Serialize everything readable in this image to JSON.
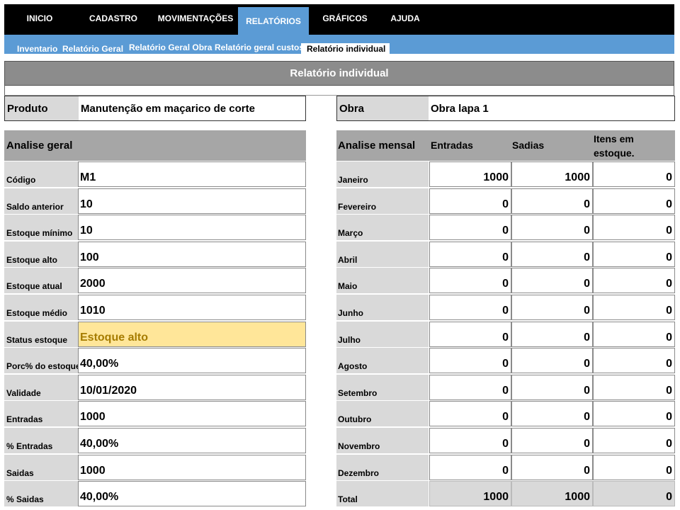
{
  "nav": {
    "items": [
      "INICIO",
      "CADASTRO",
      "MOVIMENTAÇÕES",
      "RELATÓRIOS",
      "GRÁFICOS",
      "AJUDA"
    ],
    "active": "RELATÓRIOS"
  },
  "subnav": {
    "tabs": [
      "Inventario",
      "Relatório  Geral",
      "Relatório  Geral Obra",
      "Relatório  geral custos",
      "Relatório  individual"
    ],
    "active": "Relatório  individual"
  },
  "title": "Relatório individual",
  "produto": {
    "label": "Produto",
    "value": "Manutenção em maçarico de corte"
  },
  "obra": {
    "label": "Obra",
    "value": "Obra lapa 1"
  },
  "analise_geral": {
    "header": "Analise geral",
    "rows": [
      {
        "label": "Código",
        "value": "M1"
      },
      {
        "label": "Saldo anterior",
        "value": "10"
      },
      {
        "label": "Estoque mínimo",
        "value": "10"
      },
      {
        "label": "Estoque alto",
        "value": "100"
      },
      {
        "label": "Estoque atual",
        "value": "2000"
      },
      {
        "label": "Estoque médio",
        "value": "1010"
      },
      {
        "label": "Status estoque",
        "value": "Estoque alto"
      },
      {
        "label": "Porc% do estoque",
        "value": "40,00%"
      },
      {
        "label": "Validade",
        "value": "10/01/2020"
      },
      {
        "label": "Entradas",
        "value": "1000"
      },
      {
        "label": "% Entradas",
        "value": "40,00%"
      },
      {
        "label": "Saidas",
        "value": "1000"
      },
      {
        "label": "% Saidas",
        "value": "40,00%"
      }
    ],
    "status_color": "#ffe699",
    "status_text_color": "#a67c00"
  },
  "analise_mensal": {
    "header": "Analise mensal",
    "col_entradas": "Entradas",
    "col_saidas": "Sadias",
    "col_itens": "Itens em estoque.",
    "rows": [
      {
        "month": "Janeiro",
        "entradas": "1000",
        "saidas": "1000",
        "itens": "0"
      },
      {
        "month": "Fevereiro",
        "entradas": "0",
        "saidas": "0",
        "itens": "0"
      },
      {
        "month": "Março",
        "entradas": "0",
        "saidas": "0",
        "itens": "0"
      },
      {
        "month": "Abril",
        "entradas": "0",
        "saidas": "0",
        "itens": "0"
      },
      {
        "month": "Maio",
        "entradas": "0",
        "saidas": "0",
        "itens": "0"
      },
      {
        "month": "Junho",
        "entradas": "0",
        "saidas": "0",
        "itens": "0"
      },
      {
        "month": "Julho",
        "entradas": "0",
        "saidas": "0",
        "itens": "0"
      },
      {
        "month": "Agosto",
        "entradas": "0",
        "saidas": "0",
        "itens": "0"
      },
      {
        "month": "Setembro",
        "entradas": "0",
        "saidas": "0",
        "itens": "0"
      },
      {
        "month": "Outubro",
        "entradas": "0",
        "saidas": "0",
        "itens": "0"
      },
      {
        "month": "Novembro",
        "entradas": "0",
        "saidas": "0",
        "itens": "0"
      },
      {
        "month": "Dezembro",
        "entradas": "0",
        "saidas": "0",
        "itens": "0"
      },
      {
        "month": "Total",
        "entradas": "1000",
        "saidas": "1000",
        "itens": "0"
      }
    ]
  },
  "colors": {
    "nav_bg": "#000000",
    "accent": "#5b9bd5",
    "title_bg": "#8c8c8c",
    "header_bg": "#a6a6a6",
    "label_bg": "#d9d9d9"
  }
}
